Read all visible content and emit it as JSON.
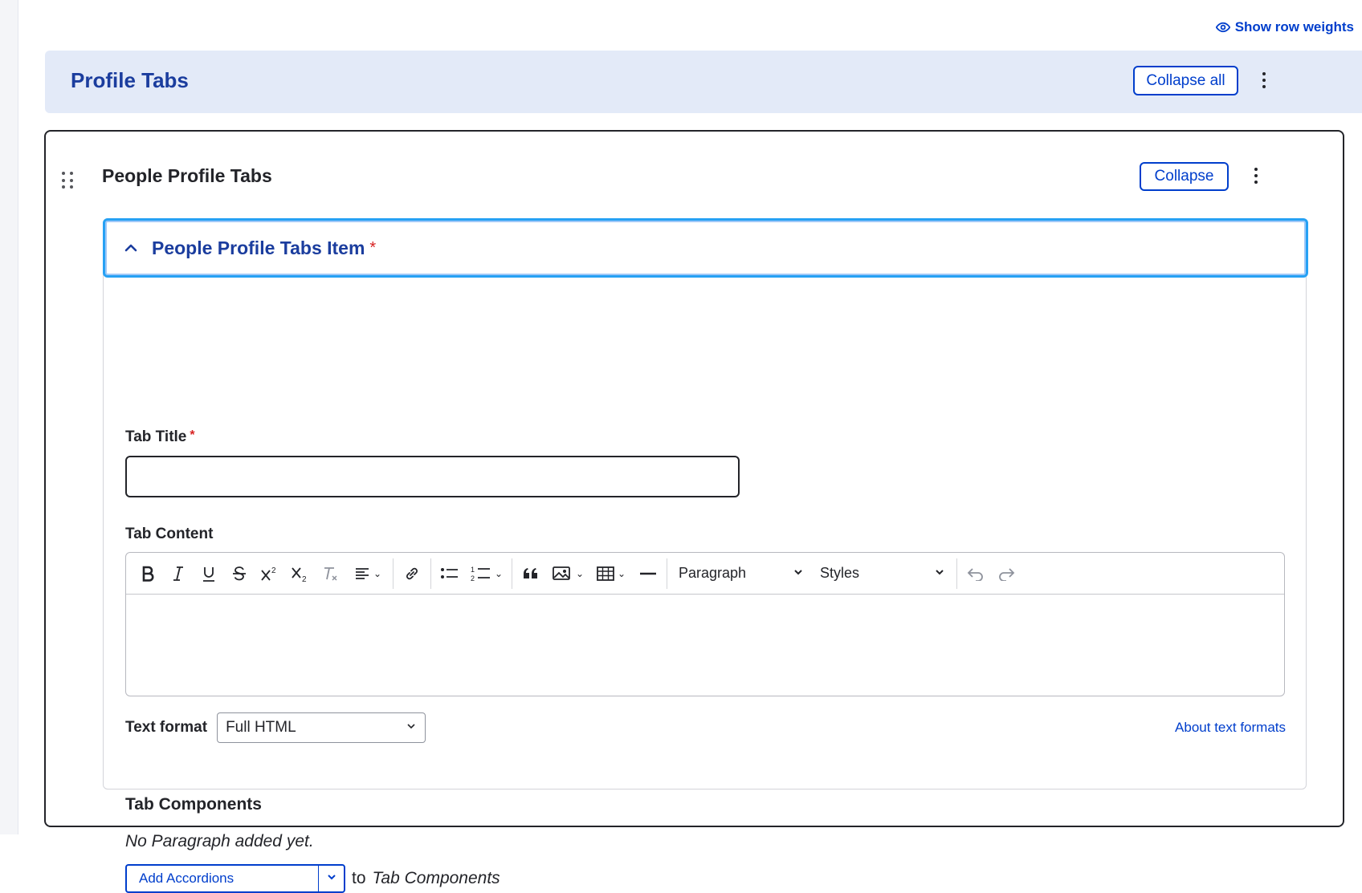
{
  "top_link": {
    "label": "Show row weights",
    "icon": "eye-icon"
  },
  "profile_header": {
    "title": "Profile Tabs",
    "collapse_all_label": "Collapse all",
    "menu_icon": "kebab-icon"
  },
  "paragraph": {
    "title": "People Profile Tabs",
    "collapse_label": "Collapse",
    "item": {
      "label": "People Profile Tabs Item",
      "required_marker": "*"
    },
    "tab_title": {
      "label": "Tab Title",
      "required_marker": "*",
      "value": "",
      "placeholder": ""
    },
    "tab_content": {
      "label": "Tab Content",
      "toolbar": {
        "buttons": [
          "bold",
          "italic",
          "underline",
          "strikethrough",
          "superscript",
          "subscript",
          "remove-format",
          "align",
          "link",
          "bulleted-list",
          "numbered-list",
          "blockquote",
          "image",
          "table",
          "horizontal-line",
          "undo",
          "redo"
        ],
        "heading_select": "Paragraph",
        "styles_select": "Styles"
      },
      "text_format_label": "Text format",
      "text_format_value": "Full HTML",
      "about_link": "About text formats"
    },
    "components": {
      "title": "Tab Components",
      "empty_message": "No Paragraph added yet.",
      "add_button": "Add Accordions",
      "to_text": "to",
      "target": "Tab Components"
    }
  },
  "colors": {
    "accent": "#003ecc",
    "header_bg": "#e3eaf8",
    "required": "#d72222",
    "focus": "#26a1f4"
  }
}
